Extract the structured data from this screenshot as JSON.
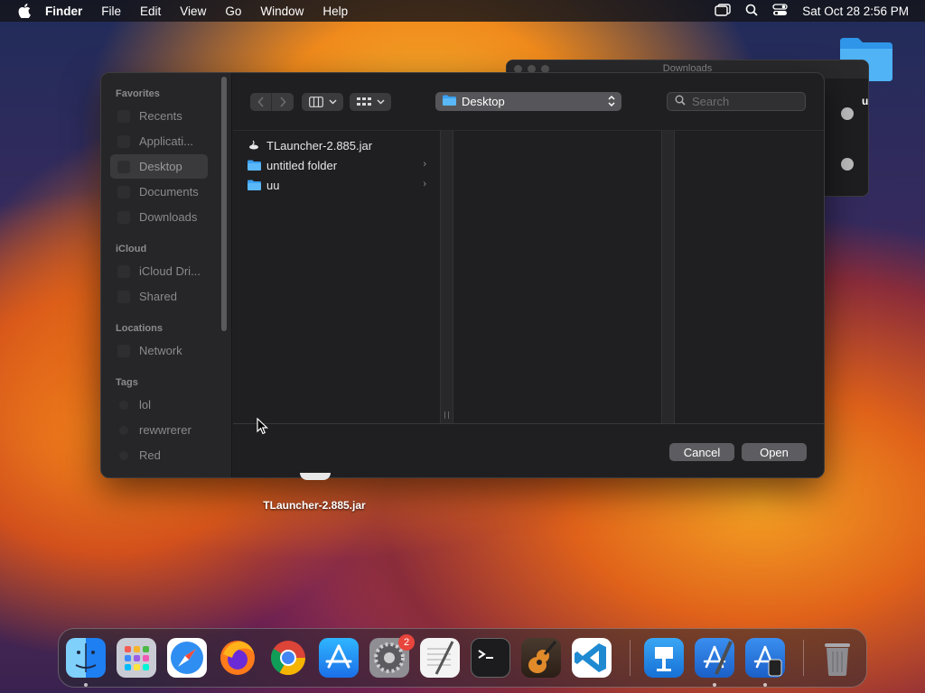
{
  "menubar": {
    "app_name": "Finder",
    "items": [
      "File",
      "Edit",
      "View",
      "Go",
      "Window",
      "Help"
    ],
    "datetime": "Sat Oct 28  2:56 PM"
  },
  "background_window": {
    "title": "Downloads",
    "partial_letter": "u"
  },
  "dialog": {
    "sidebar": {
      "sections": {
        "favorites": "Favorites",
        "icloud": "iCloud",
        "locations": "Locations",
        "tags": "Tags"
      },
      "items": {
        "recents": "Recents",
        "applications": "Applicati...",
        "desktop": "Desktop",
        "documents": "Documents",
        "downloads": "Downloads",
        "icloud_drive": "iCloud Dri...",
        "shared": "Shared",
        "network": "Network",
        "tag_lol": "lol",
        "tag_rewwrerer": "rewwrerer",
        "tag_red": "Red"
      }
    },
    "location": "Desktop",
    "search_placeholder": "Search",
    "files": [
      {
        "name": "TLauncher-2.885.jar",
        "kind": "jar"
      },
      {
        "name": "untitled folder",
        "kind": "folder"
      },
      {
        "name": "uu",
        "kind": "folder"
      }
    ],
    "buttons": {
      "cancel": "Cancel",
      "open": "Open"
    }
  },
  "desktop": {
    "file_label": "TLauncher-2.885.jar"
  },
  "dock": {
    "apps": [
      "Finder",
      "Launchpad",
      "Safari",
      "Firefox",
      "Chrome",
      "App Store",
      "System Settings",
      "TextEdit",
      "Terminal",
      "GarageBand",
      "Visual Studio Code",
      "Keynote",
      "Xcode",
      "Simulator",
      "Trash"
    ],
    "settings_badge": "2"
  },
  "colors": {
    "accent": "#2f8ef2",
    "folder": "#3aa0f0",
    "badge": "#e8453c"
  }
}
